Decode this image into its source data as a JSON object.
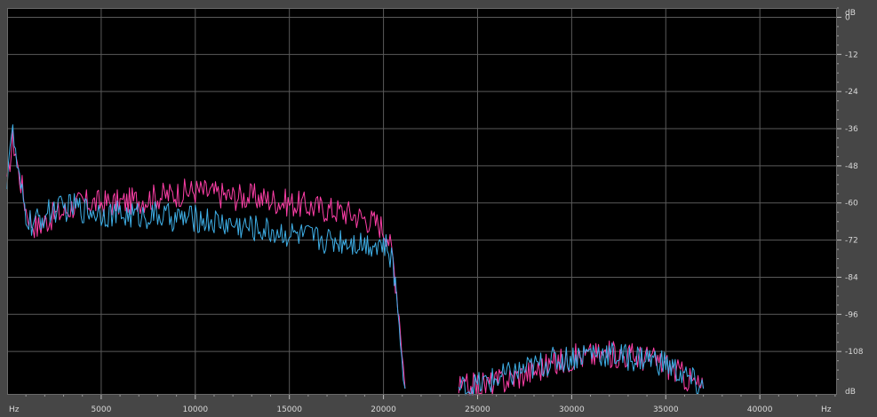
{
  "chart_data": {
    "type": "line",
    "x_unit": "Hz",
    "y_unit": "dB",
    "xlim": [
      0,
      44100
    ],
    "ylim": [
      -122,
      3
    ],
    "x_ticks": [
      5000,
      10000,
      15000,
      20000,
      25000,
      30000,
      35000,
      40000
    ],
    "x_tick_labels": [
      "5000",
      "10000",
      "15000",
      "20000",
      "25000",
      "30000",
      "35000",
      "40000"
    ],
    "y_ticks": [
      0,
      -12,
      -24,
      -36,
      -48,
      -60,
      -72,
      -84,
      -96,
      -108
    ],
    "y_tick_labels": [
      "0",
      "-12",
      "-24",
      "-36",
      "-48",
      "-60",
      "-72",
      "-84",
      "-96",
      "-108"
    ],
    "grid": true,
    "background": "#000000",
    "grid_color": "#5a5a5a",
    "series": [
      {
        "color": "#ff3fa8",
        "x": [
          0,
          150,
          300,
          450,
          600,
          800,
          1000,
          1300,
          1600,
          2000,
          2500,
          3000,
          3500,
          4000,
          5000,
          6000,
          7000,
          8000,
          9000,
          10000,
          11000,
          12000,
          13000,
          14000,
          15000,
          16000,
          17000,
          18000,
          19000,
          19800,
          20200,
          20500,
          20700,
          20900,
          21050,
          21150
        ],
        "y": [
          -55,
          -46,
          -40,
          -43,
          -50,
          -55,
          -62,
          -66,
          -68,
          -66,
          -64,
          -63,
          -61,
          -60,
          -60,
          -60,
          -59,
          -58,
          -57,
          -56,
          -57,
          -58,
          -58,
          -59,
          -60,
          -61,
          -62,
          -63,
          -65,
          -67,
          -70,
          -78,
          -88,
          -100,
          -112,
          -120
        ]
      },
      {
        "color": "#3fb0e8",
        "x": [
          0,
          150,
          300,
          450,
          600,
          800,
          1000,
          1300,
          1600,
          2000,
          2500,
          3000,
          3500,
          4000,
          5000,
          6000,
          7000,
          8000,
          9000,
          10000,
          11000,
          12000,
          13000,
          14000,
          15000,
          16000,
          17000,
          18000,
          19000,
          19800,
          20200,
          20500,
          20700,
          20900,
          21050,
          21150
        ],
        "y": [
          -52,
          -40,
          -38,
          -44,
          -52,
          -58,
          -64,
          -67,
          -66,
          -64,
          -62,
          -62,
          -61,
          -62,
          -63,
          -64,
          -64,
          -64,
          -65,
          -65,
          -66,
          -67,
          -68,
          -69,
          -70,
          -71,
          -72,
          -72,
          -73,
          -73,
          -75,
          -80,
          -90,
          -102,
          -113,
          -120
        ]
      },
      {
        "color": "#ff3fa8",
        "x": [
          24000,
          25000,
          26000,
          27000,
          28000,
          29000,
          30000,
          31000,
          32000,
          33000,
          34000,
          35000,
          35500,
          36000,
          36500,
          37000
        ],
        "y": [
          -120,
          -119,
          -118,
          -116,
          -114,
          -112,
          -110,
          -109,
          -109,
          -109,
          -110,
          -112,
          -114,
          -116,
          -118,
          -120
        ]
      },
      {
        "color": "#3fb0e8",
        "x": [
          24000,
          25000,
          26000,
          27000,
          28000,
          29000,
          30000,
          31000,
          32000,
          33000,
          34000,
          35000,
          35500,
          36000,
          36500,
          37000
        ],
        "y": [
          -120,
          -119,
          -117,
          -115,
          -113,
          -111,
          -110,
          -108,
          -109,
          -110,
          -110,
          -112,
          -114,
          -116,
          -118,
          -120
        ]
      }
    ],
    "axis_labels": {
      "x_left": "Hz",
      "x_right": "Hz",
      "y_top": "dB",
      "y_bottom": "dB"
    }
  }
}
